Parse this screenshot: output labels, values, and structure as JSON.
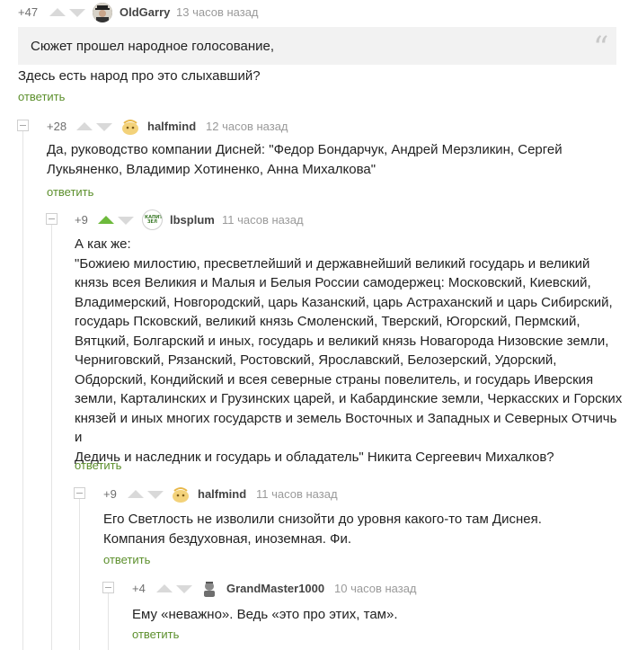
{
  "comments": [
    {
      "score": "+47",
      "author": "OldGarry",
      "time": "13 часов назад",
      "quote": "Сюжет прошел народное голосование,",
      "text": "Здесь есть народ про это слыхавший?",
      "reply": "ответить"
    },
    {
      "score": "+28",
      "author": "halfmind",
      "time": "12 часов назад",
      "lines": [
        "Да, руководство компании Дисней: \"Федор Бондарчук, Андрей Мерзликин, Сергей",
        "Лукьяненко, Владимир Хотиненко, Анна Михалкова\""
      ],
      "reply": "ответить"
    },
    {
      "score": "+9",
      "author": "lbsplum",
      "time": "11 часов назад",
      "avatar_text": "КАПИТАЛ ЗЕЛ",
      "lines": [
        "А как же:",
        "\"Божиею милостию, пресветлейший и державнейший великий государь и великий",
        "князь всея Великия и Малыя и Белыя России самодержец: Московский, Киевский,",
        "Владимерский, Новгородский, царь Казанский, царь Астраханский и царь Сибирский,",
        "государь Псковский, великий князь Смоленский, Тверский, Югорский, Пермский,",
        "Вятцкий, Болгарский и иных, государь и великий князь Новагорода Низовские земли,",
        "Черниговский, Рязанский, Ростовский, Ярославский, Белозерский, Удорский,",
        "Обдорский, Кондийский и всея северные страны повелитель, и государь Иверския",
        "земли, Карталинских и Грузинских царей, и Кабардинские земли, Черкасских и Горских",
        "князей и иных многих государств и земель Восточных и Западных и Северных Отчичь и",
        "Дедичь и наследник и государь и обладатель\" Никита Сергеевич Михалков?"
      ],
      "reply": "ответить"
    },
    {
      "score": "+9",
      "author": "halfmind",
      "time": "11 часов назад",
      "lines": [
        "Его Светлость не изволили снизойти до уровня какого-то там Диснея.",
        "Компания бездуховная, иноземная. Фи."
      ],
      "reply": "ответить"
    },
    {
      "score": "+4",
      "author": "GrandMaster1000",
      "time": "10 часов назад",
      "lines": [
        "Ему «неважно». Ведь «это про этих, там»."
      ],
      "reply": "ответить"
    }
  ],
  "icons": {
    "upvote": "arrow-up-icon",
    "downvote": "arrow-down-icon",
    "collapse": "collapse-toggle-icon",
    "quote": "quote-mark-icon"
  },
  "colors": {
    "upvote_active": "#6dba3c",
    "reply_link": "#5c8f2c",
    "quote_bg": "#f2f2f2"
  }
}
